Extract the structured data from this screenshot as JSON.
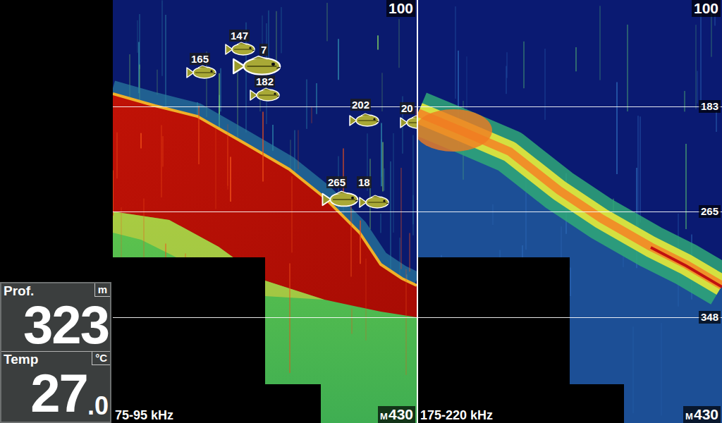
{
  "panels": [
    {
      "frequency": "75-95 kHz",
      "top_depth": "100",
      "bottom_depth": "430",
      "mode": "M"
    },
    {
      "frequency": "175-220 kHz",
      "top_depth": "100",
      "bottom_depth": "430",
      "mode": "M"
    }
  ],
  "depth_lines": [
    "183",
    "265",
    "348"
  ],
  "fish": [
    {
      "depth": "147",
      "kind": "small"
    },
    {
      "depth": "165",
      "kind": "small"
    },
    {
      "depth": "7",
      "kind": "large"
    },
    {
      "depth": "182",
      "kind": "small"
    },
    {
      "depth": "202",
      "kind": "small"
    },
    {
      "depth": "20",
      "kind": "small"
    },
    {
      "depth": "265",
      "kind": "medium"
    },
    {
      "depth": "18",
      "kind": "small"
    }
  ],
  "readout": {
    "depth_label": "Prof.",
    "depth_unit": "m",
    "depth": "323",
    "temp_label": "Temp",
    "temp_unit": "°C",
    "temp_whole": "27",
    "temp_decimal": ".0"
  }
}
